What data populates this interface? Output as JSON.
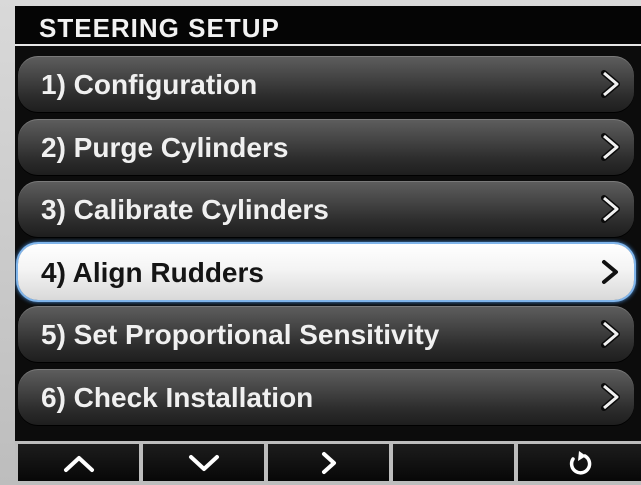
{
  "title": "STEERING SETUP",
  "menu": {
    "items": [
      {
        "label": "1) Configuration"
      },
      {
        "label": "2) Purge Cylinders"
      },
      {
        "label": "3) Calibrate Cylinders"
      },
      {
        "label": "4) Align Rudders",
        "selected": true
      },
      {
        "label": "5) Set Proportional Sensitivity"
      },
      {
        "label": "6) Check Installation"
      }
    ],
    "item_arrow_icon": "chevron-right-icon"
  },
  "softkeys": [
    {
      "icon": "chevron-up-icon"
    },
    {
      "icon": "chevron-down-icon"
    },
    {
      "icon": "chevron-right-icon"
    },
    {
      "icon": ""
    },
    {
      "icon": "back-arrow-icon"
    }
  ],
  "colors": {
    "screen_bg": "#0c0c0c",
    "item_text": "#f0f0f0",
    "selected_item_bg": "#f4f4f4",
    "selected_glow": "#4a90dc"
  }
}
